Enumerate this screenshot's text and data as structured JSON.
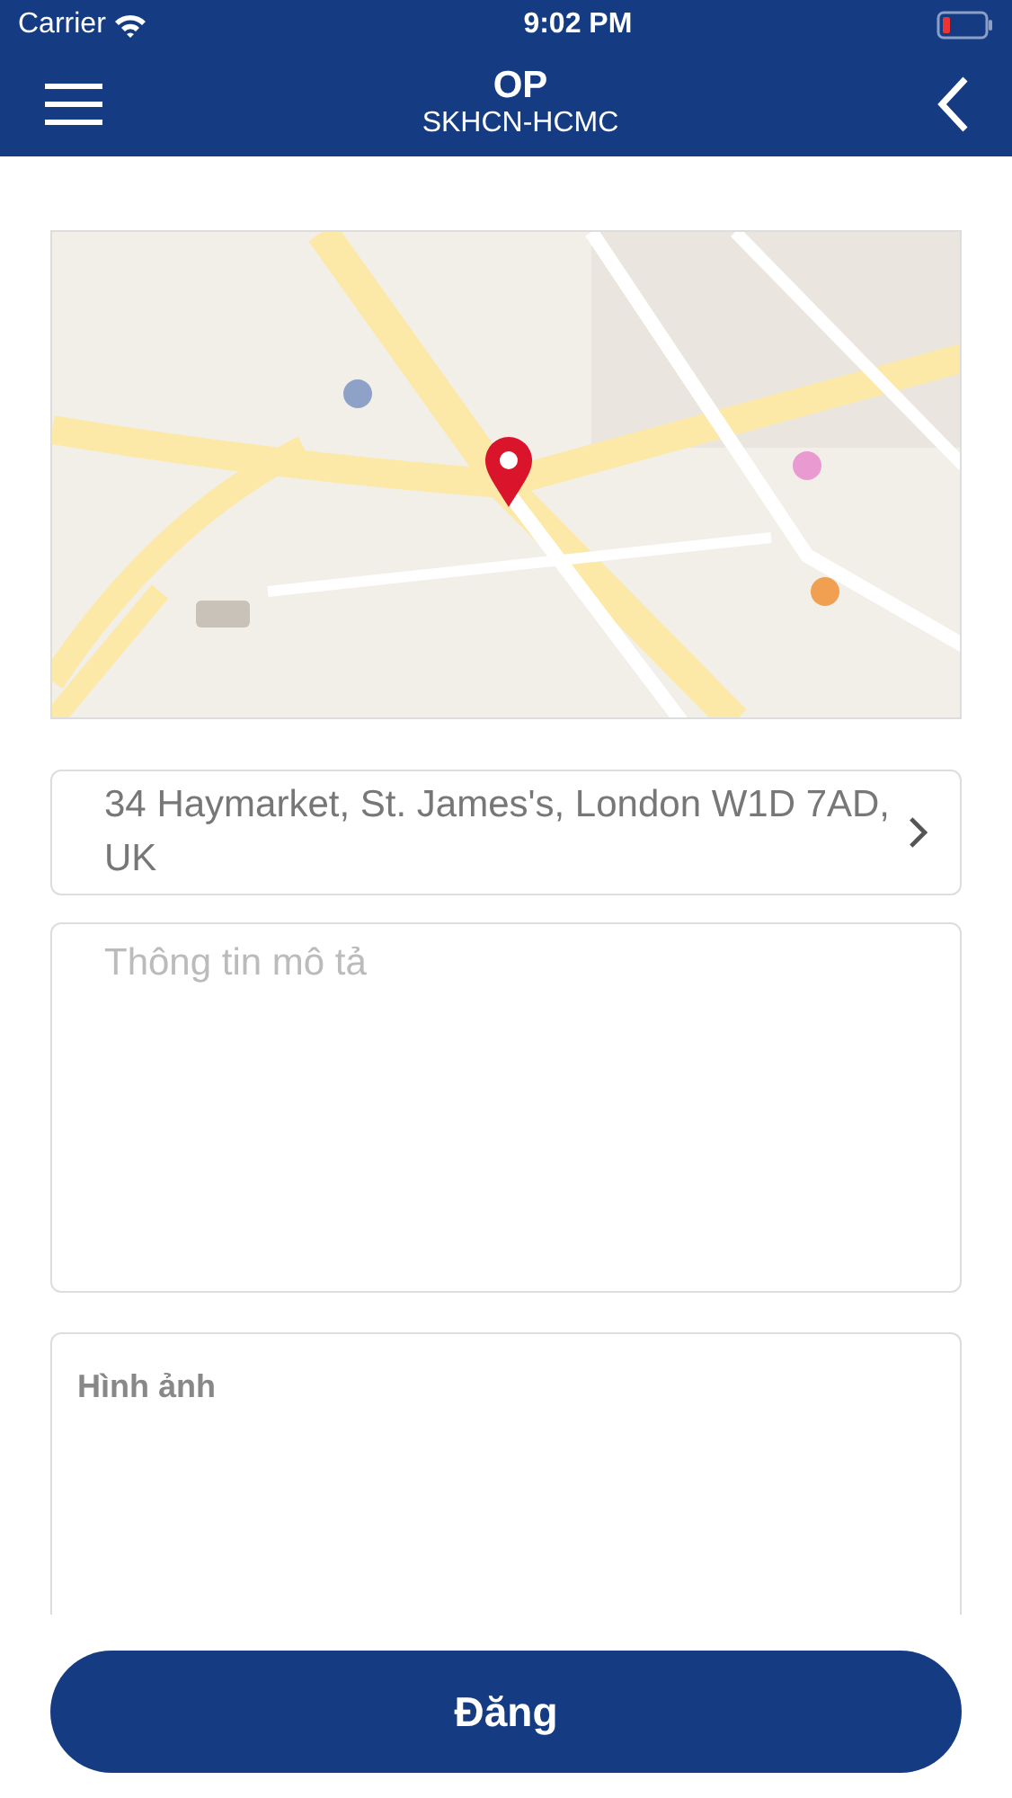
{
  "status_bar": {
    "carrier": "Carrier",
    "time": "9:02 PM"
  },
  "nav": {
    "title": "OP",
    "subtitle": "SKHCN-HCMC"
  },
  "address": {
    "value": "34 Haymarket, St. James's, London W1D 7AD, UK"
  },
  "description": {
    "placeholder": "Thông tin mô tả"
  },
  "images": {
    "label": "Hình ảnh"
  },
  "submit": {
    "label": "Đăng"
  }
}
